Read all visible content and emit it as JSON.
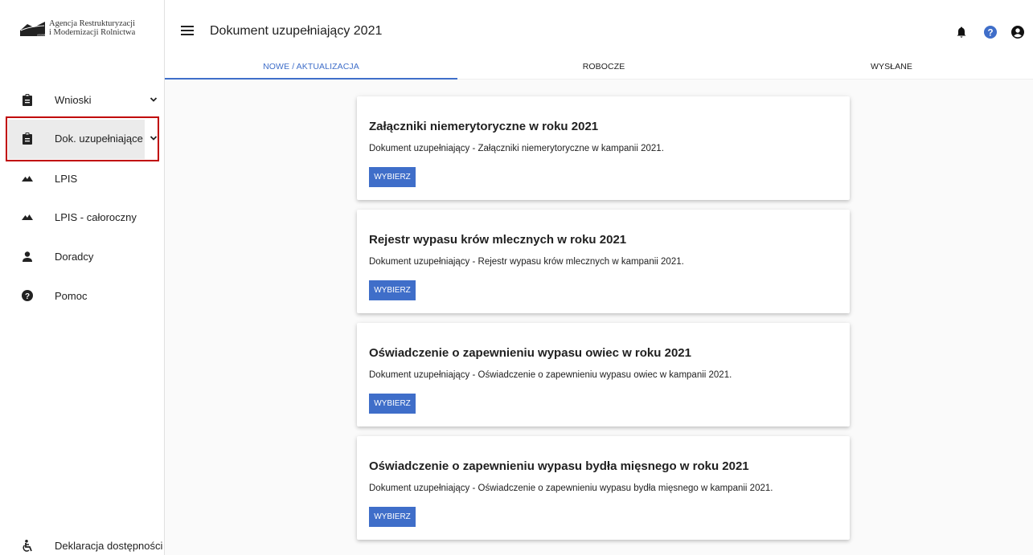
{
  "logo": {
    "line1": "Agencja Restrukturyzacji",
    "line2": "i Modernizacji Rolnictwa"
  },
  "header": {
    "title": "Dokument uzupełniający 2021",
    "tabs": [
      {
        "label": "NOWE / AKTUALIZACJA",
        "active": true
      },
      {
        "label": "ROBOCZE",
        "active": false
      },
      {
        "label": "WYSŁANE",
        "active": false
      }
    ],
    "icons": [
      "bell-icon",
      "help-circle-icon",
      "account-icon"
    ]
  },
  "sidebar": {
    "items": [
      {
        "label": "Wnioski",
        "icon": "clipboard-icon",
        "expandable": true
      },
      {
        "label": "Dok. uzupełniające",
        "icon": "clipboard-icon",
        "expandable": true,
        "active": true
      },
      {
        "label": "LPIS",
        "icon": "landscape-icon"
      },
      {
        "label": "LPIS - całoroczny",
        "icon": "landscape-icon"
      },
      {
        "label": "Doradcy",
        "icon": "person-icon"
      },
      {
        "label": "Pomoc",
        "icon": "help-circle-icon"
      }
    ],
    "footer": {
      "label": "Deklaracja dostępności",
      "icon": "accessibility-icon"
    }
  },
  "cards": [
    {
      "title": "Załączniki niemerytoryczne w roku 2021",
      "description": "Dokument uzupełniający - Załączniki niemerytoryczne w kampanii 2021.",
      "button": "WYBIERZ"
    },
    {
      "title": "Rejestr wypasu krów mlecznych w roku 2021",
      "description": "Dokument uzupełniający - Rejestr wypasu krów mlecznych w kampanii 2021.",
      "button": "WYBIERZ"
    },
    {
      "title": "Oświadczenie o zapewnieniu wypasu owiec w roku 2021",
      "description": "Dokument uzupełniający - Oświadczenie o zapewnieniu wypasu owiec w kampanii 2021.",
      "button": "WYBIERZ"
    },
    {
      "title": "Oświadczenie o zapewnieniu wypasu bydła mięsnego w roku 2021",
      "description": "Dokument uzupełniający - Oświadczenie o zapewnieniu wypasu bydła mięsnego w kampanii 2021.",
      "button": "WYBIERZ"
    }
  ],
  "colors": {
    "accent": "#3f6ec9",
    "highlight": "#c00000",
    "active_bg": "#ebebeb"
  }
}
